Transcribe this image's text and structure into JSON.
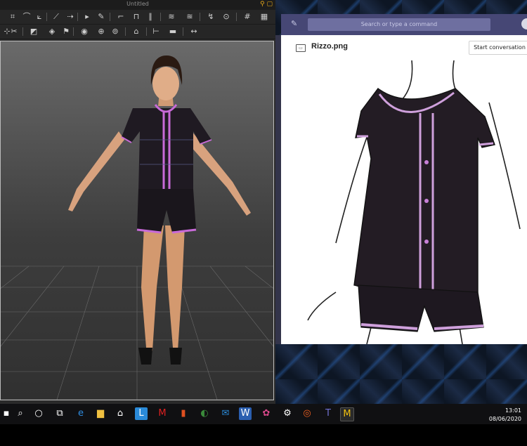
{
  "app": {
    "title": "Untitled",
    "window_controls": "⚲ ▢"
  },
  "teams": {
    "search_placeholder": "Search or type a command",
    "file_name": "Rizzo.png",
    "start_conversation": "Start conversation"
  },
  "taskbar": {
    "time": "13:01",
    "date": "08/06/2020"
  },
  "colors": {
    "teams_bar": "#464775",
    "trim_pink": "#c86ad8",
    "garment": "#1f1a22",
    "skin": "#d8a27e"
  }
}
